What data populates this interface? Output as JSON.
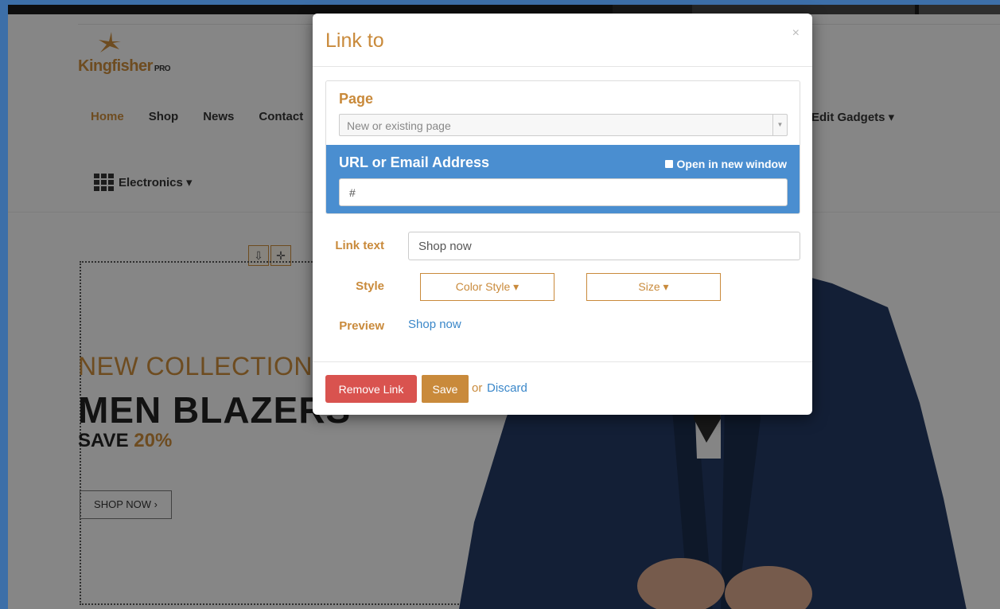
{
  "site": {
    "logo": {
      "name": "Kingfisher",
      "suffix": "PRO"
    },
    "nav": {
      "items": [
        {
          "label": "Home",
          "active": true
        },
        {
          "label": "Shop"
        },
        {
          "label": "News"
        },
        {
          "label": "Contact"
        }
      ],
      "gadgets": "Edit Gadgets ▾",
      "electronics": "Electronics ▾"
    },
    "hero": {
      "subtitle": "NEW COLLECTION",
      "title": "MEN BLAZERS",
      "save_prefix": "SAVE ",
      "save_pct": "20%",
      "cta": "SHOP NOW ›"
    },
    "edit_tools": [
      "⇩",
      "✛"
    ]
  },
  "modal": {
    "title": "Link to",
    "close": "×",
    "page_section": {
      "label": "Page",
      "placeholder": "New or existing page"
    },
    "url_section": {
      "label": "URL or Email Address",
      "new_window": "Open in new window",
      "value": "#"
    },
    "link_text": {
      "label": "Link text",
      "value": "Shop now"
    },
    "style": {
      "label": "Style",
      "color_button": "Color Style ▾",
      "size_button": "Size ▾"
    },
    "preview": {
      "label": "Preview",
      "value": "Shop now"
    },
    "footer": {
      "remove": "Remove Link",
      "save": "Save",
      "or": "or",
      "discard": "Discard"
    }
  },
  "colors": {
    "accent": "#c98a3b",
    "url_panel": "#4a8ed0",
    "remove": "#d9534f",
    "link": "#3a87c9"
  }
}
